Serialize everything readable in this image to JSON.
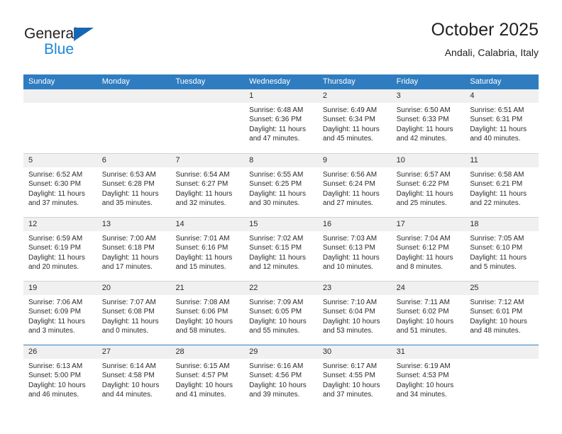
{
  "logo": {
    "word_top": "General",
    "word_bottom": "Blue",
    "triangle_icon": "triangle-icon",
    "colors": {
      "dark": "#231f20",
      "blue": "#1a87dc",
      "triangle": "#1567b3"
    }
  },
  "header": {
    "title": "October 2025",
    "location": "Andali, Calabria, Italy"
  },
  "calendar": {
    "accent_color": "#2f7dc0",
    "daynum_band_color": "#f0f0f0",
    "weekday_headers": [
      "Sunday",
      "Monday",
      "Tuesday",
      "Wednesday",
      "Thursday",
      "Friday",
      "Saturday"
    ],
    "weeks": [
      [
        {
          "day": ""
        },
        {
          "day": ""
        },
        {
          "day": ""
        },
        {
          "day": "1",
          "sunrise": "Sunrise: 6:48 AM",
          "sunset": "Sunset: 6:36 PM",
          "daylight": "Daylight: 11 hours and 47 minutes."
        },
        {
          "day": "2",
          "sunrise": "Sunrise: 6:49 AM",
          "sunset": "Sunset: 6:34 PM",
          "daylight": "Daylight: 11 hours and 45 minutes."
        },
        {
          "day": "3",
          "sunrise": "Sunrise: 6:50 AM",
          "sunset": "Sunset: 6:33 PM",
          "daylight": "Daylight: 11 hours and 42 minutes."
        },
        {
          "day": "4",
          "sunrise": "Sunrise: 6:51 AM",
          "sunset": "Sunset: 6:31 PM",
          "daylight": "Daylight: 11 hours and 40 minutes."
        }
      ],
      [
        {
          "day": "5",
          "sunrise": "Sunrise: 6:52 AM",
          "sunset": "Sunset: 6:30 PM",
          "daylight": "Daylight: 11 hours and 37 minutes."
        },
        {
          "day": "6",
          "sunrise": "Sunrise: 6:53 AM",
          "sunset": "Sunset: 6:28 PM",
          "daylight": "Daylight: 11 hours and 35 minutes."
        },
        {
          "day": "7",
          "sunrise": "Sunrise: 6:54 AM",
          "sunset": "Sunset: 6:27 PM",
          "daylight": "Daylight: 11 hours and 32 minutes."
        },
        {
          "day": "8",
          "sunrise": "Sunrise: 6:55 AM",
          "sunset": "Sunset: 6:25 PM",
          "daylight": "Daylight: 11 hours and 30 minutes."
        },
        {
          "day": "9",
          "sunrise": "Sunrise: 6:56 AM",
          "sunset": "Sunset: 6:24 PM",
          "daylight": "Daylight: 11 hours and 27 minutes."
        },
        {
          "day": "10",
          "sunrise": "Sunrise: 6:57 AM",
          "sunset": "Sunset: 6:22 PM",
          "daylight": "Daylight: 11 hours and 25 minutes."
        },
        {
          "day": "11",
          "sunrise": "Sunrise: 6:58 AM",
          "sunset": "Sunset: 6:21 PM",
          "daylight": "Daylight: 11 hours and 22 minutes."
        }
      ],
      [
        {
          "day": "12",
          "sunrise": "Sunrise: 6:59 AM",
          "sunset": "Sunset: 6:19 PM",
          "daylight": "Daylight: 11 hours and 20 minutes."
        },
        {
          "day": "13",
          "sunrise": "Sunrise: 7:00 AM",
          "sunset": "Sunset: 6:18 PM",
          "daylight": "Daylight: 11 hours and 17 minutes."
        },
        {
          "day": "14",
          "sunrise": "Sunrise: 7:01 AM",
          "sunset": "Sunset: 6:16 PM",
          "daylight": "Daylight: 11 hours and 15 minutes."
        },
        {
          "day": "15",
          "sunrise": "Sunrise: 7:02 AM",
          "sunset": "Sunset: 6:15 PM",
          "daylight": "Daylight: 11 hours and 12 minutes."
        },
        {
          "day": "16",
          "sunrise": "Sunrise: 7:03 AM",
          "sunset": "Sunset: 6:13 PM",
          "daylight": "Daylight: 11 hours and 10 minutes."
        },
        {
          "day": "17",
          "sunrise": "Sunrise: 7:04 AM",
          "sunset": "Sunset: 6:12 PM",
          "daylight": "Daylight: 11 hours and 8 minutes."
        },
        {
          "day": "18",
          "sunrise": "Sunrise: 7:05 AM",
          "sunset": "Sunset: 6:10 PM",
          "daylight": "Daylight: 11 hours and 5 minutes."
        }
      ],
      [
        {
          "day": "19",
          "sunrise": "Sunrise: 7:06 AM",
          "sunset": "Sunset: 6:09 PM",
          "daylight": "Daylight: 11 hours and 3 minutes."
        },
        {
          "day": "20",
          "sunrise": "Sunrise: 7:07 AM",
          "sunset": "Sunset: 6:08 PM",
          "daylight": "Daylight: 11 hours and 0 minutes."
        },
        {
          "day": "21",
          "sunrise": "Sunrise: 7:08 AM",
          "sunset": "Sunset: 6:06 PM",
          "daylight": "Daylight: 10 hours and 58 minutes."
        },
        {
          "day": "22",
          "sunrise": "Sunrise: 7:09 AM",
          "sunset": "Sunset: 6:05 PM",
          "daylight": "Daylight: 10 hours and 55 minutes."
        },
        {
          "day": "23",
          "sunrise": "Sunrise: 7:10 AM",
          "sunset": "Sunset: 6:04 PM",
          "daylight": "Daylight: 10 hours and 53 minutes."
        },
        {
          "day": "24",
          "sunrise": "Sunrise: 7:11 AM",
          "sunset": "Sunset: 6:02 PM",
          "daylight": "Daylight: 10 hours and 51 minutes."
        },
        {
          "day": "25",
          "sunrise": "Sunrise: 7:12 AM",
          "sunset": "Sunset: 6:01 PM",
          "daylight": "Daylight: 10 hours and 48 minutes."
        }
      ],
      [
        {
          "day": "26",
          "sunrise": "Sunrise: 6:13 AM",
          "sunset": "Sunset: 5:00 PM",
          "daylight": "Daylight: 10 hours and 46 minutes."
        },
        {
          "day": "27",
          "sunrise": "Sunrise: 6:14 AM",
          "sunset": "Sunset: 4:58 PM",
          "daylight": "Daylight: 10 hours and 44 minutes."
        },
        {
          "day": "28",
          "sunrise": "Sunrise: 6:15 AM",
          "sunset": "Sunset: 4:57 PM",
          "daylight": "Daylight: 10 hours and 41 minutes."
        },
        {
          "day": "29",
          "sunrise": "Sunrise: 6:16 AM",
          "sunset": "Sunset: 4:56 PM",
          "daylight": "Daylight: 10 hours and 39 minutes."
        },
        {
          "day": "30",
          "sunrise": "Sunrise: 6:17 AM",
          "sunset": "Sunset: 4:55 PM",
          "daylight": "Daylight: 10 hours and 37 minutes."
        },
        {
          "day": "31",
          "sunrise": "Sunrise: 6:19 AM",
          "sunset": "Sunset: 4:53 PM",
          "daylight": "Daylight: 10 hours and 34 minutes."
        },
        {
          "day": ""
        }
      ]
    ]
  }
}
